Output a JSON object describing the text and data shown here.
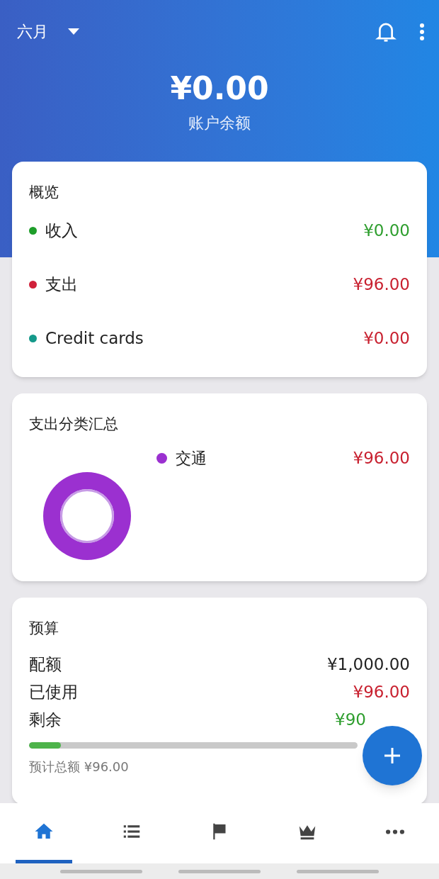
{
  "header": {
    "month": "六月",
    "balance": "¥0.00",
    "balance_label": "账户余额"
  },
  "overview": {
    "title": "概览",
    "items": [
      {
        "label": "收入",
        "amount": "¥0.00",
        "color": "#1e9e2a",
        "kind": "income"
      },
      {
        "label": "支出",
        "amount": "¥96.00",
        "color": "#d0213a",
        "kind": "expense"
      },
      {
        "label": "Credit cards",
        "amount": "¥0.00",
        "color": "#14998a",
        "kind": "expense"
      }
    ]
  },
  "categories": {
    "title": "支出分类汇总",
    "items": [
      {
        "label": "交通",
        "amount": "¥96.00",
        "color": "#9b30d0"
      }
    ]
  },
  "budget": {
    "title": "预算",
    "rows": [
      {
        "label": "配额",
        "value": "¥1,000.00",
        "kind": "total"
      },
      {
        "label": "已使用",
        "value": "¥96.00",
        "kind": "expense"
      },
      {
        "label": "剩余",
        "value": "¥90",
        "kind": "income"
      }
    ],
    "level": 0.096,
    "projected": "预计总额 ¥96.00"
  },
  "nav": [
    {
      "selected": true
    },
    {
      "selected": false
    },
    {
      "selected": false
    },
    {
      "selected": false
    },
    {
      "selected": false
    }
  ]
}
